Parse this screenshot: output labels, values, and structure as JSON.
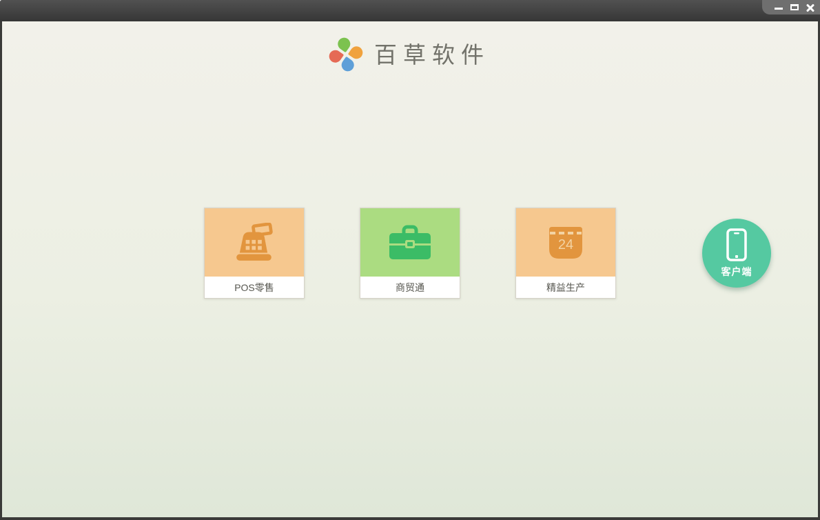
{
  "window": {
    "controls": {
      "minimize": "minimize",
      "maximize": "maximize",
      "close": "close"
    }
  },
  "header": {
    "app_name": "百草软件",
    "logo_icon": "pinwheel-icon",
    "logo_petal_colors": [
      "#7cc24f",
      "#f0a23e",
      "#5e9fd8",
      "#e56a55"
    ]
  },
  "products": [
    {
      "label": "POS零售",
      "icon": "cash-register-icon",
      "tile_color": "#f6c88f",
      "icon_color": "#e2953e"
    },
    {
      "label": "商贸通",
      "icon": "briefcase-icon",
      "tile_color": "#abdc81",
      "icon_color": "#3bbc66"
    },
    {
      "label": "精益生产",
      "icon": "calendar-icon",
      "tile_color": "#f6c88f",
      "icon_color": "#e2953e",
      "calendar_day": "24"
    }
  ],
  "client": {
    "label": "客户端",
    "icon": "smartphone-icon",
    "color": "#55c9a1"
  },
  "colors": {
    "titlebar_top": "#515151",
    "titlebar_bottom": "#363636",
    "background_top": "#f2f1ea",
    "background_bottom": "#dfe7d8",
    "logo_text": "#72726a"
  }
}
